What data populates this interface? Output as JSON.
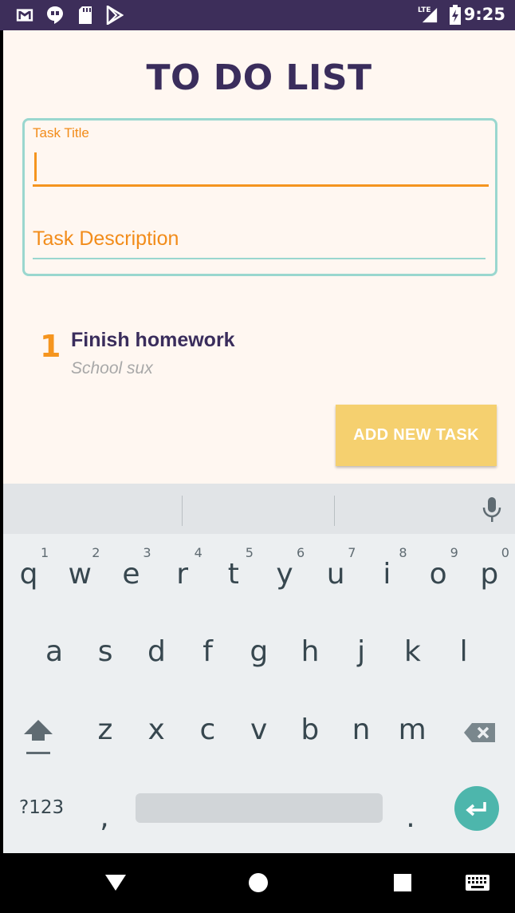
{
  "status_bar": {
    "time": "9:25",
    "network_label": "LTE",
    "icons": [
      "gmail-icon",
      "hangouts-icon",
      "sd-card-icon",
      "play-store-icon",
      "signal-icon",
      "battery-charging-icon"
    ]
  },
  "app": {
    "title": "TO DO LIST",
    "form": {
      "title_label": "Task Title",
      "title_value": "",
      "description_placeholder": "Task Description"
    },
    "tasks": [
      {
        "number": "1",
        "title": "Finish homework",
        "description": "School sux"
      }
    ],
    "add_button_label": "ADD NEW TASK",
    "colors": {
      "title": "#3a2d5c",
      "accent": "#f5951f",
      "card_border": "#9ad7cf",
      "button": "#f5d06f",
      "background": "#fff7f1"
    }
  },
  "keyboard": {
    "row1_hints": [
      "1",
      "2",
      "3",
      "4",
      "5",
      "6",
      "7",
      "8",
      "9",
      "0"
    ],
    "row1": [
      "q",
      "w",
      "e",
      "r",
      "t",
      "y",
      "u",
      "i",
      "o",
      "p"
    ],
    "row2": [
      "a",
      "s",
      "d",
      "f",
      "g",
      "h",
      "j",
      "k",
      "l"
    ],
    "row3": [
      "z",
      "x",
      "c",
      "v",
      "b",
      "n",
      "m"
    ],
    "symbols_label": "?123",
    "comma": ",",
    "period": "."
  },
  "nav_bar": {
    "icons": [
      "back-icon",
      "home-icon",
      "recents-icon",
      "keyboard-switch-icon"
    ]
  }
}
